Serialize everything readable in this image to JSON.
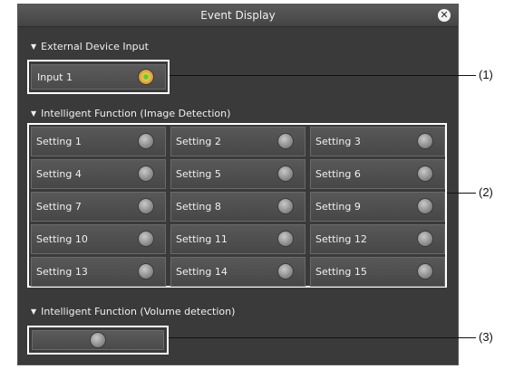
{
  "window": {
    "title": "Event Display"
  },
  "sections": {
    "external": {
      "title": "External Device Input",
      "items": [
        {
          "label": "Input 1",
          "state": "on"
        }
      ]
    },
    "image_detection": {
      "title": "Intelligent Function (Image Detection)",
      "items": [
        {
          "label": "Setting 1"
        },
        {
          "label": "Setting 2"
        },
        {
          "label": "Setting 3"
        },
        {
          "label": "Setting 4"
        },
        {
          "label": "Setting 5"
        },
        {
          "label": "Setting 6"
        },
        {
          "label": "Setting 7"
        },
        {
          "label": "Setting 8"
        },
        {
          "label": "Setting 9"
        },
        {
          "label": "Setting 10"
        },
        {
          "label": "Setting 11"
        },
        {
          "label": "Setting 12"
        },
        {
          "label": "Setting 13"
        },
        {
          "label": "Setting 14"
        },
        {
          "label": "Setting 15"
        }
      ]
    },
    "volume_detection": {
      "title": "Intelligent Function (Volume detection)"
    }
  },
  "callouts": [
    "(1)",
    "(2)",
    "(3)"
  ],
  "colors": {
    "window_bg": "#3a3a3a",
    "indicator_on": "#5bd12a",
    "highlight": "#ffffff"
  }
}
